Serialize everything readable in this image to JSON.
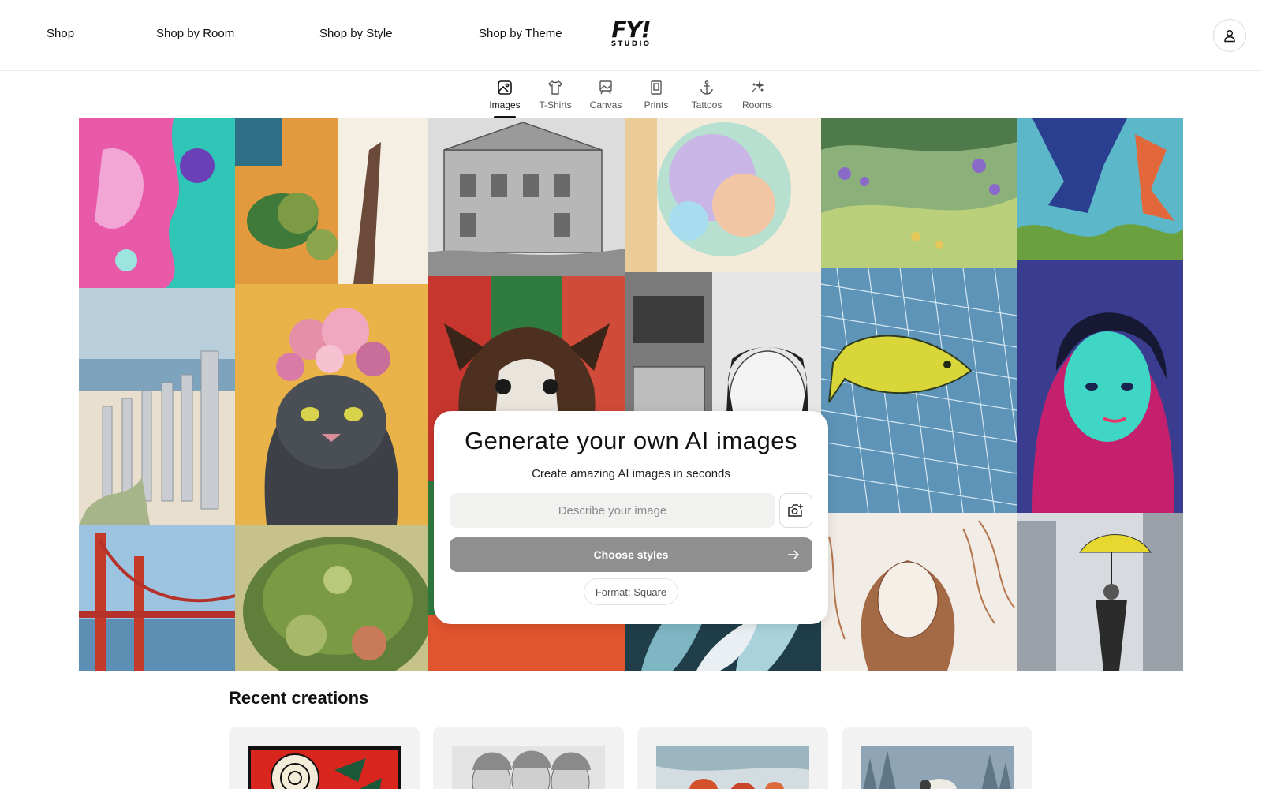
{
  "topnav": {
    "links": [
      {
        "label": "Shop"
      },
      {
        "label": "Shop by Room"
      },
      {
        "label": "Shop by Style"
      },
      {
        "label": "Shop by Theme"
      }
    ],
    "logo": {
      "main": "FY!",
      "sub": "STUDIO"
    },
    "account_icon": "user-icon"
  },
  "tabs": [
    {
      "label": "Images",
      "icon": "image-icon",
      "active": true
    },
    {
      "label": "T-Shirts",
      "icon": "tshirt-icon",
      "active": false
    },
    {
      "label": "Canvas",
      "icon": "canvas-icon",
      "active": false
    },
    {
      "label": "Prints",
      "icon": "print-icon",
      "active": false
    },
    {
      "label": "Tattoos",
      "icon": "anchor-icon",
      "active": false
    },
    {
      "label": "Rooms",
      "icon": "sparkle-icon",
      "active": false
    }
  ],
  "generator": {
    "title": "Generate your own AI images",
    "subtitle": "Create amazing AI images in seconds",
    "prompt_placeholder": "Describe your image",
    "prompt_value": "",
    "upload_icon": "camera-plus-icon",
    "choose_styles_label": "Choose styles",
    "format_label": "Format: Square"
  },
  "recent": {
    "title": "Recent creations",
    "items": [
      {
        "name": "rose-artwork"
      },
      {
        "name": "sketch-women-artwork"
      },
      {
        "name": "watercolor-lobster-artwork"
      },
      {
        "name": "foggy-sheep-artwork"
      }
    ]
  },
  "colors": {
    "accent_dark": "#111111",
    "button_gray": "#8f8f8f",
    "input_bg": "#f1f1ef"
  }
}
